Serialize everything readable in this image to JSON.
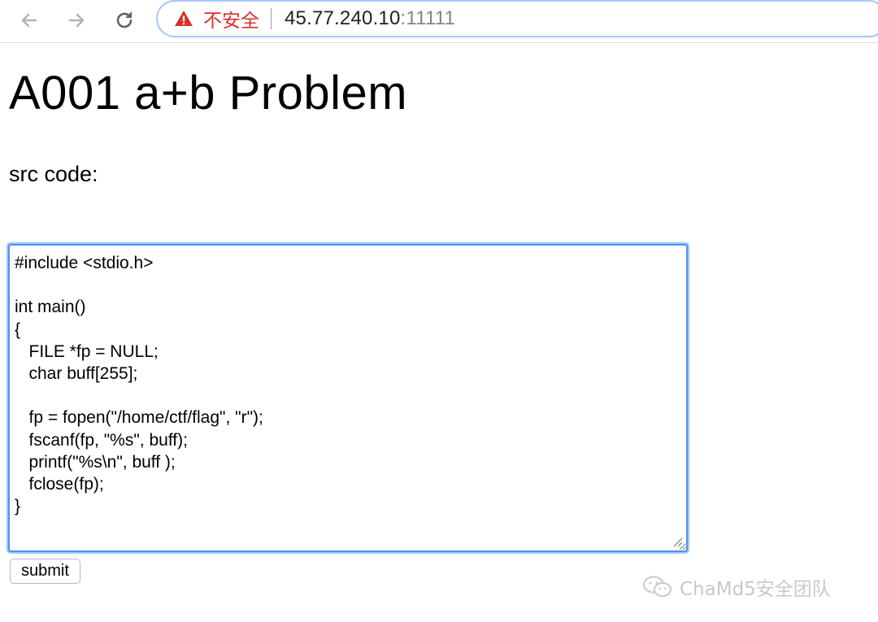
{
  "browser": {
    "insecure_label": "不安全",
    "url_host": "45.77.240.10",
    "url_port": ":11111"
  },
  "page": {
    "title": "A001 a+b Problem",
    "src_label": "src code:",
    "code": "#include <stdio.h>\n\nint main()\n{\n   FILE *fp = NULL;\n   char buff[255];\n\n   fp = fopen(\"/home/ctf/flag\", \"r\");\n   fscanf(fp, \"%s\", buff);\n   printf(\"%s\\n\", buff );\n   fclose(fp);\n}",
    "submit_label": "submit"
  },
  "watermark": {
    "text": "ChaMd5安全团队",
    "icon": "wechat-icon"
  },
  "colors": {
    "insecure_red": "#d93025",
    "focus_blue": "#4d90fe",
    "watermark_gray": "#c9c9c9"
  }
}
